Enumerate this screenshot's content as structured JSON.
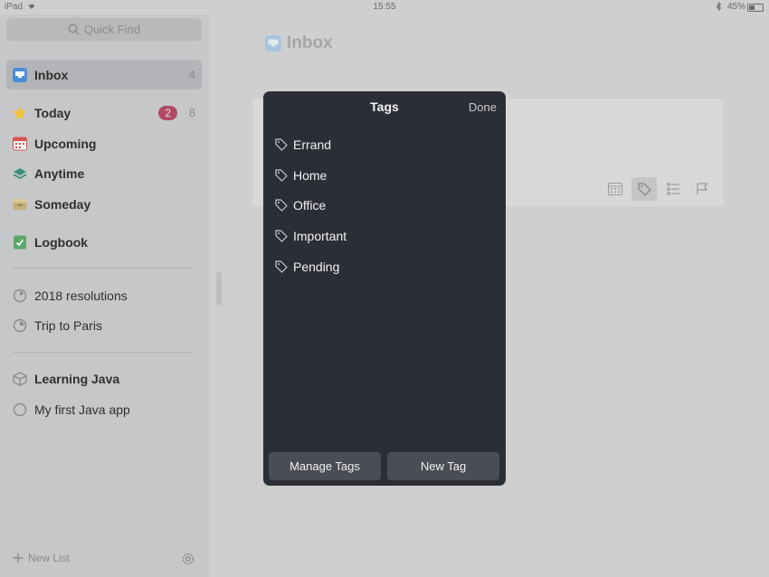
{
  "status_bar": {
    "device": "iPad",
    "time": "15:55",
    "battery": "45%"
  },
  "sidebar": {
    "search_placeholder": "Quick Find",
    "inbox": {
      "label": "Inbox",
      "count": "4"
    },
    "today": {
      "label": "Today",
      "badge": "2",
      "count": "8"
    },
    "upcoming": {
      "label": "Upcoming"
    },
    "anytime": {
      "label": "Anytime"
    },
    "someday": {
      "label": "Someday"
    },
    "logbook": {
      "label": "Logbook"
    },
    "projects": [
      {
        "label": "2018 resolutions"
      },
      {
        "label": "Trip to Paris"
      }
    ],
    "area": {
      "label": "Learning Java"
    },
    "area_projects": [
      {
        "label": "My first Java app"
      }
    ],
    "new_list": "New List"
  },
  "main": {
    "title": "Inbox"
  },
  "tags_popover": {
    "title": "Tags",
    "done": "Done",
    "tags": [
      {
        "label": "Errand"
      },
      {
        "label": "Home"
      },
      {
        "label": "Office"
      },
      {
        "label": "Important"
      },
      {
        "label": "Pending"
      }
    ],
    "manage_button": "Manage Tags",
    "new_button": "New Tag"
  },
  "colors": {
    "inbox": "#4a8fd6",
    "today": "#f1c232",
    "upcoming": "#d9534f",
    "anytime": "#3c8f7c",
    "someday": "#c5b07a",
    "logbook": "#5ba86b",
    "badge": "#b04a62"
  }
}
